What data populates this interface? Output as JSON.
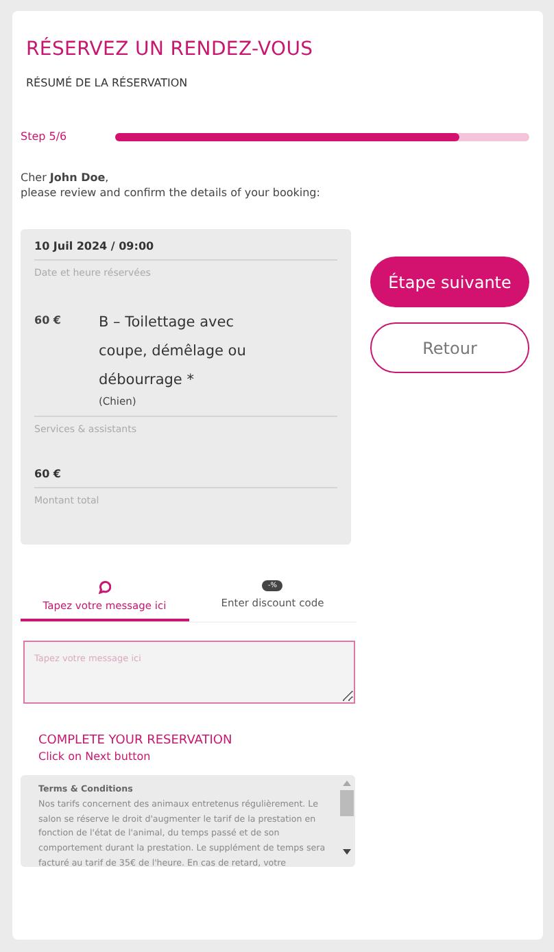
{
  "title": "RÉSERVEZ UN RENDEZ-VOUS",
  "subtitle": "RÉSUMÉ DE LA RÉSERVATION",
  "progress": {
    "label": "Step 5/6",
    "level": 0.83
  },
  "greeting": "Cher **John Doe**,",
  "intro": "please review and confirm the details of your booking:",
  "summary": {
    "datetime": "10 Juil 2024 / 09:00",
    "datetime_label": "Date et heure réservées",
    "service": {
      "price": "60 €",
      "name": "B – Toilettage avec coupe, démêlage ou débourrage *",
      "note": "(Chien)"
    },
    "services_label": "Services & assistants",
    "total": "60 €",
    "total_label": "Montant total"
  },
  "buttons": [
    {
      "kind": "primary",
      "label": "Étape suivante"
    },
    {
      "kind": "secondary",
      "label": "Retour"
    }
  ],
  "tabs": [
    {
      "kind": "message",
      "label": "Tapez votre message ici",
      "selected": true
    },
    {
      "kind": "discount",
      "label": "Enter discount code",
      "badge": "-%",
      "selected": false
    }
  ],
  "message": {
    "placeholder": "Tapez votre message ici"
  },
  "complete": {
    "heading": "COMPLETE YOUR RESERVATION",
    "hint": "Click on Next button"
  },
  "terms": {
    "title": "Terms & Conditions",
    "text": "Nos tarifs concernent des animaux entretenus régulièrement. Le salon se réserve le droit d'augmenter le tarif de la prestation en fonction de l'état de l'animal, du temps passé et de son comportement durant la prestation. Le supplément de temps sera facturé au tarif de 35€ de l'heure. En cas de retard, votre"
  }
}
